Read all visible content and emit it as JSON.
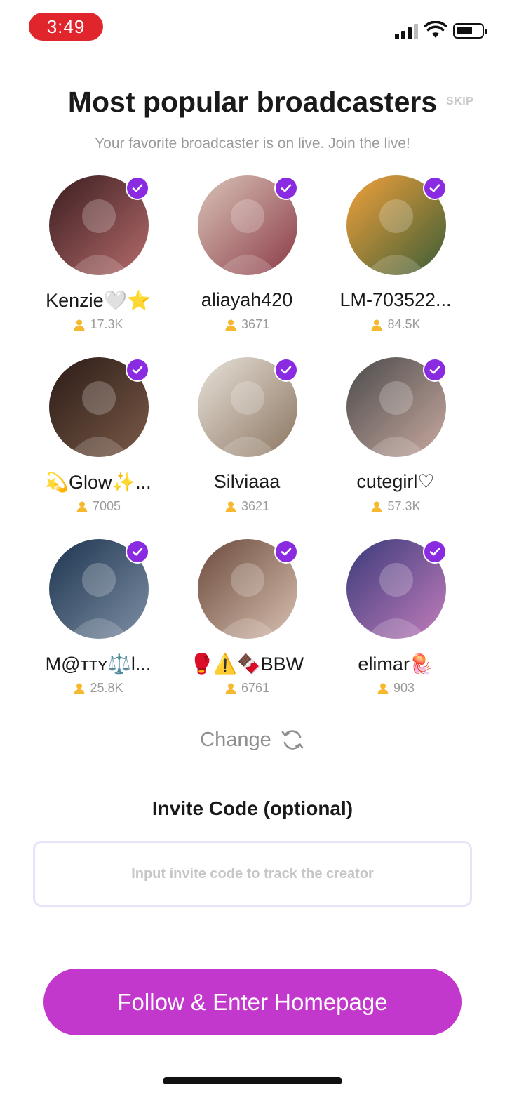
{
  "status_bar": {
    "time": "3:49"
  },
  "header": {
    "title": "Most popular broadcasters",
    "skip_label": "SKIP",
    "subtitle": "Your favorite broadcaster is on live. Join the live!"
  },
  "broadcasters": [
    {
      "name": "Kenzie🤍⭐",
      "fans": "17.3K",
      "verified": true
    },
    {
      "name": "aliayah420",
      "fans": "3671",
      "verified": true
    },
    {
      "name": "LM-703522...",
      "fans": "84.5K",
      "verified": true
    },
    {
      "name": "💫Glow✨...",
      "fans": "7005",
      "verified": true
    },
    {
      "name": "Silviaaa",
      "fans": "3621",
      "verified": true
    },
    {
      "name": "cutegirl♡",
      "fans": "57.3K",
      "verified": true
    },
    {
      "name": "M@ᴛᴛʏ⚖️l...",
      "fans": "25.8K",
      "verified": true
    },
    {
      "name": "🥊⚠️🍫BBW",
      "fans": "6761",
      "verified": true
    },
    {
      "name": "elimar🪼",
      "fans": "903",
      "verified": true
    }
  ],
  "change": {
    "label": "Change",
    "icon": "refresh-icon"
  },
  "invite": {
    "label": "Invite Code (optional)",
    "value": "",
    "placeholder": "Input invite code to track the creator"
  },
  "cta": {
    "label": "Follow & Enter Homepage"
  },
  "colors": {
    "accent_purple": "#8a2be2",
    "cta_magenta": "#c338cc",
    "fans_gold": "#f5b82e",
    "time_pill_red": "#e0262c"
  }
}
